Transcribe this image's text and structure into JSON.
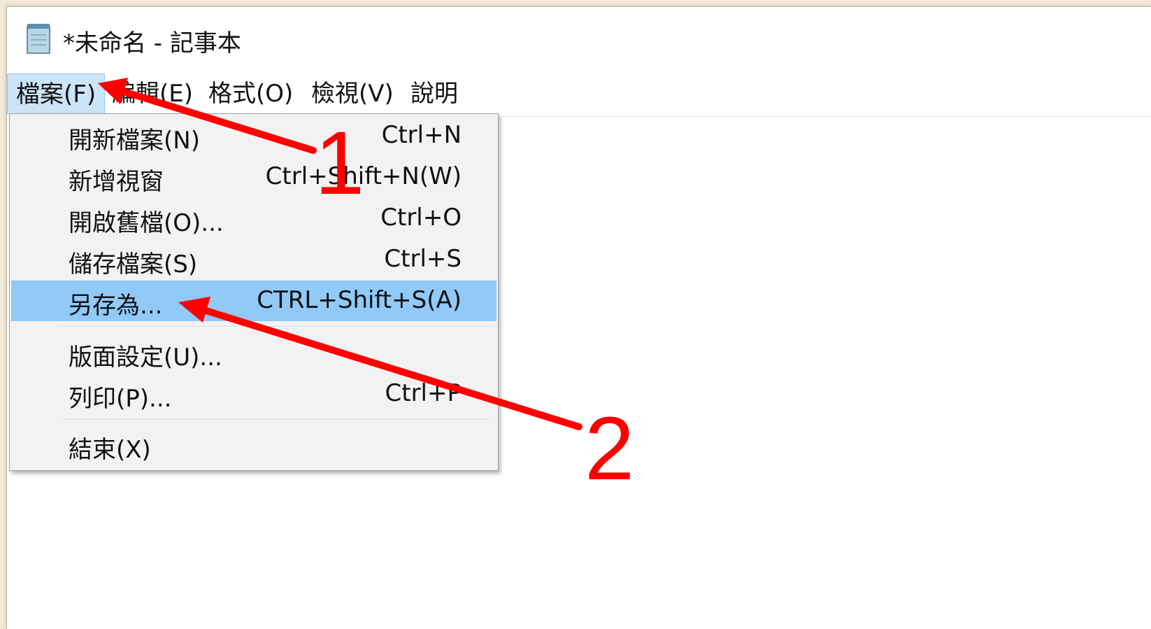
{
  "window": {
    "title": "*未命名 - 記事本",
    "icon": "notepad-icon"
  },
  "menubar": {
    "items": [
      {
        "label": "檔案(F)",
        "active": true
      },
      {
        "label": "編輯(E)"
      },
      {
        "label": "格式(O)"
      },
      {
        "label": "檢視(V)"
      },
      {
        "label": "說明"
      }
    ]
  },
  "file_menu": {
    "items": [
      {
        "label": "開新檔案(N)",
        "shortcut": "Ctrl+N"
      },
      {
        "label": "新增視窗",
        "shortcut": "Ctrl+Shift+N(W)"
      },
      {
        "label": "開啟舊檔(O)...",
        "shortcut": "Ctrl+O"
      },
      {
        "label": "儲存檔案(S)",
        "shortcut": "Ctrl+S"
      },
      {
        "label": "另存為...",
        "shortcut": "CTRL+Shift+S(A)",
        "highlighted": true
      },
      {
        "label": "版面設定(U)..."
      },
      {
        "label": "列印(P)...",
        "shortcut": "Ctrl+P"
      },
      {
        "label": "結束(X)"
      }
    ]
  },
  "annotations": {
    "step1": "1",
    "step2": "2",
    "color": "#ff0000"
  },
  "colors": {
    "highlight": "#91c9f7",
    "menu_active": "#cce4f7",
    "menu_bg": "#f2f2f2"
  }
}
